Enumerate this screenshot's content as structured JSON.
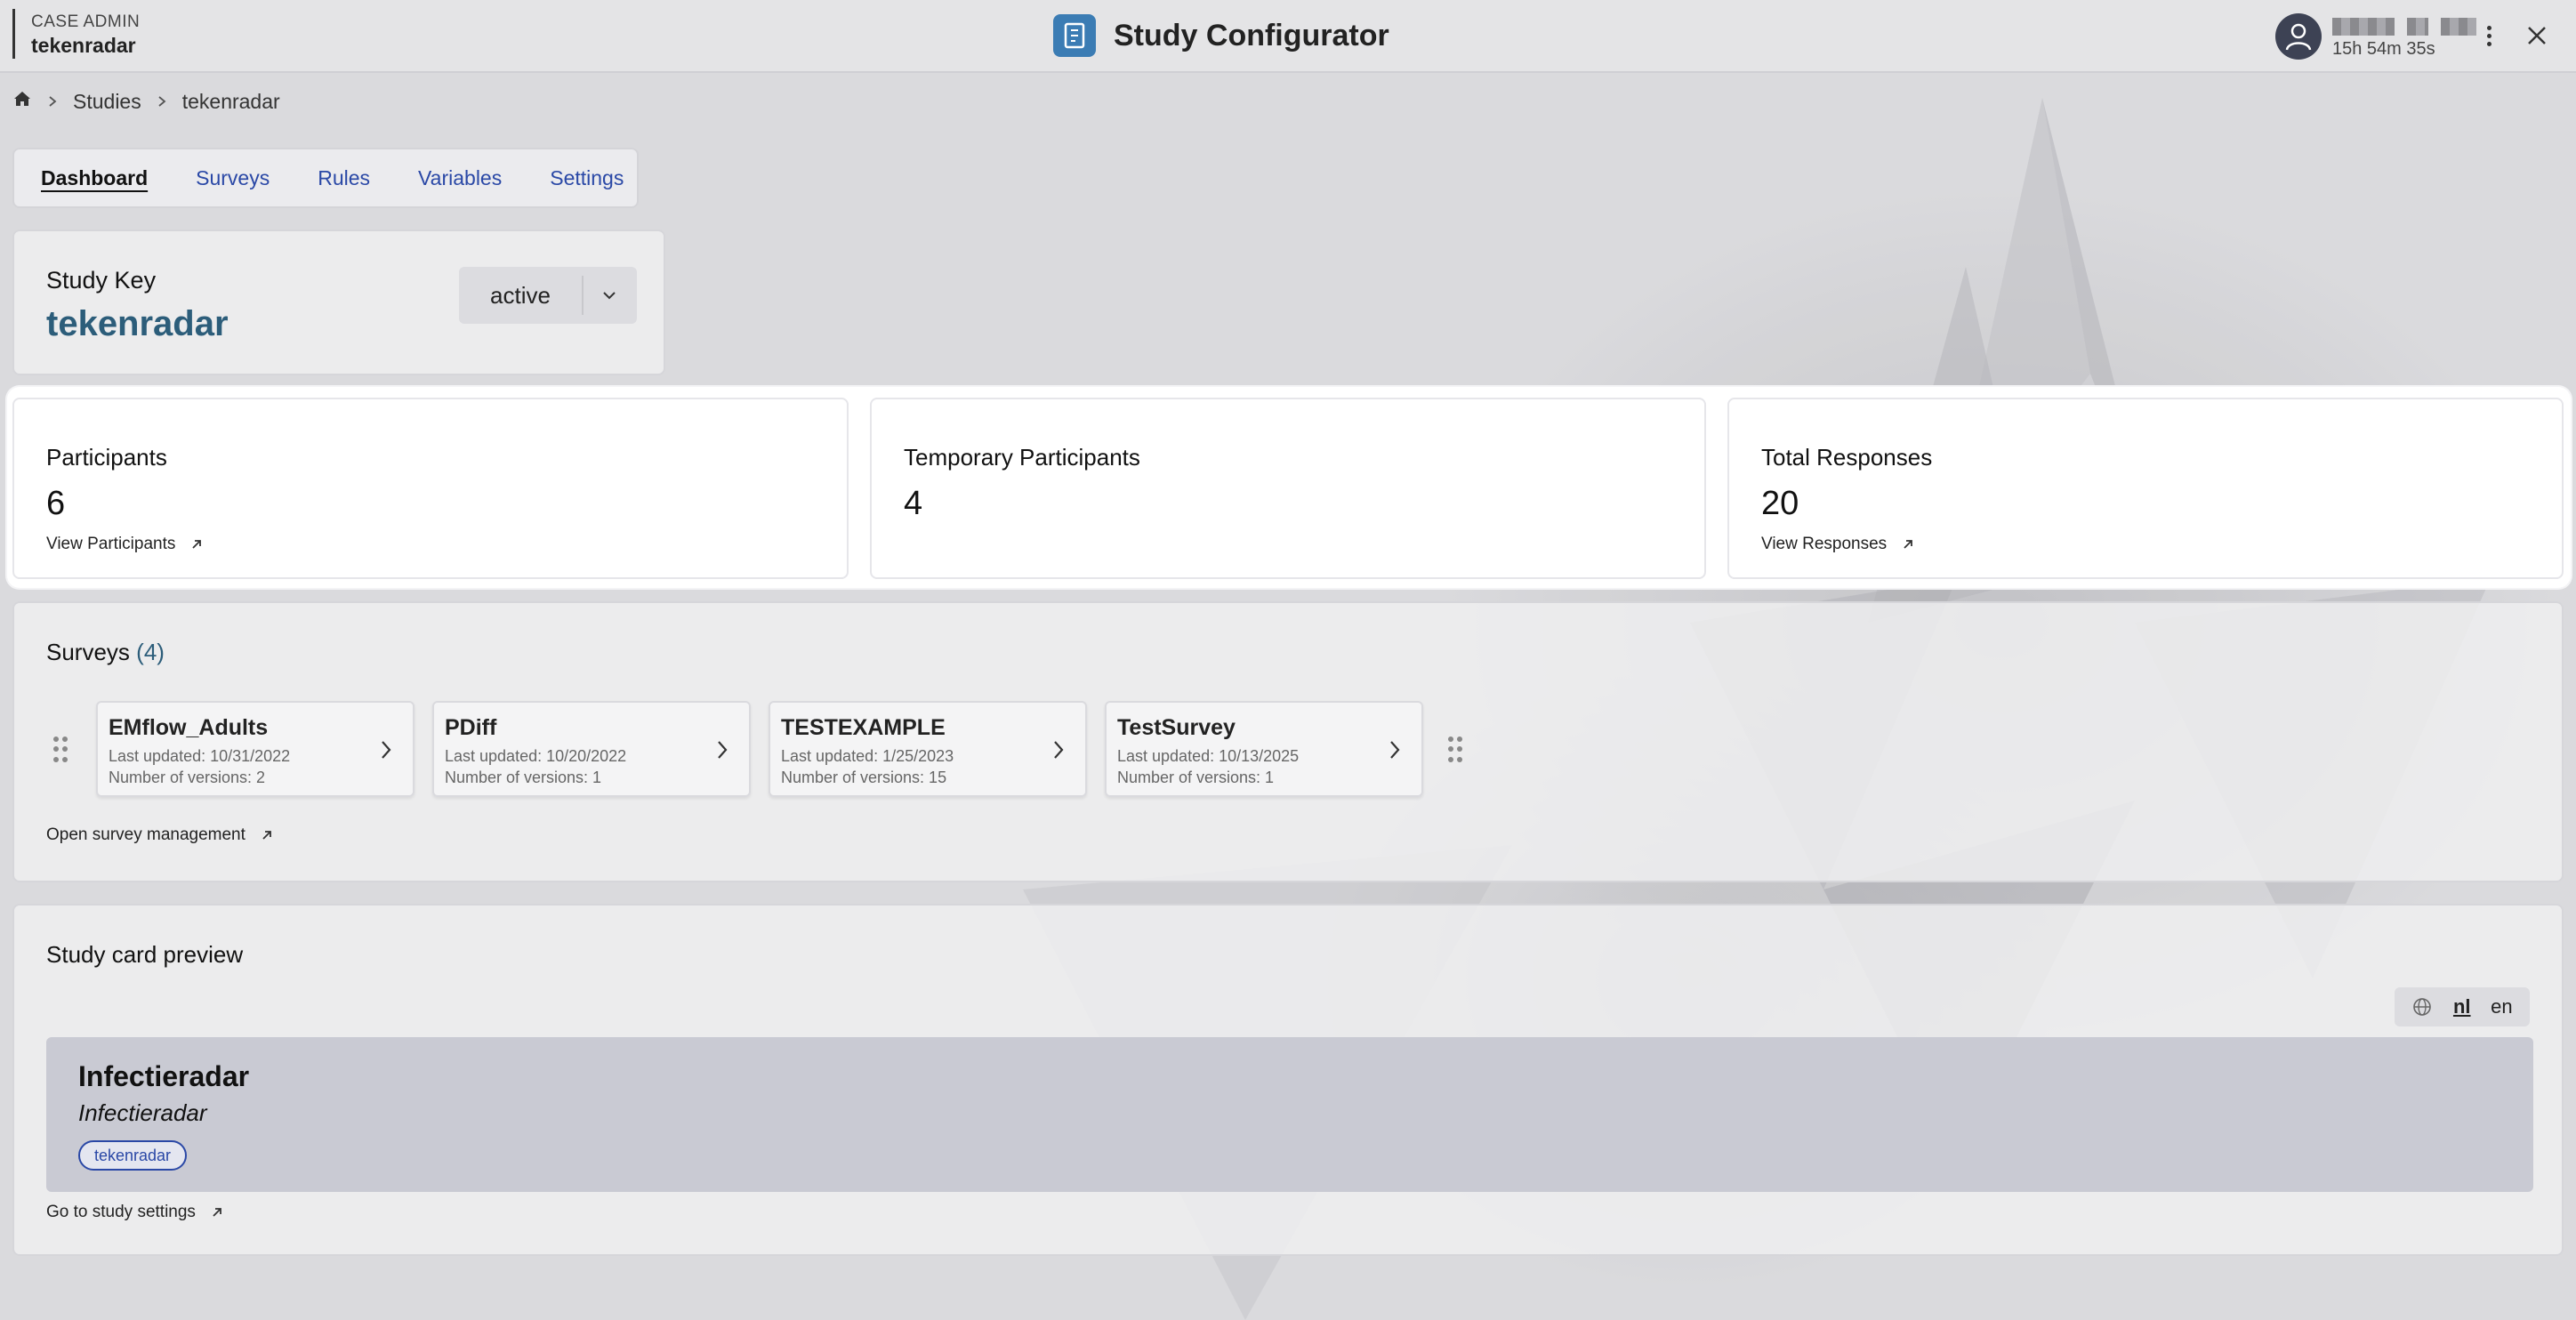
{
  "header": {
    "role_label": "CASE ADMIN",
    "role_name": "tekenradar",
    "app_title": "Study Configurator",
    "session_timer": "15h 54m 35s"
  },
  "breadcrumb": {
    "items": [
      "Studies",
      "tekenradar"
    ]
  },
  "tabs": [
    {
      "label": "Dashboard",
      "active": true
    },
    {
      "label": "Surveys",
      "active": false
    },
    {
      "label": "Rules",
      "active": false
    },
    {
      "label": "Variables",
      "active": false
    },
    {
      "label": "Settings",
      "active": false
    }
  ],
  "study_key": {
    "label": "Study Key",
    "value": "tekenradar",
    "status": "active"
  },
  "stats": [
    {
      "title": "Participants",
      "value": "6",
      "link": "View Participants"
    },
    {
      "title": "Temporary Participants",
      "value": "4",
      "link": ""
    },
    {
      "title": "Total Responses",
      "value": "20",
      "link": "View Responses"
    }
  ],
  "surveys": {
    "title": "Surveys",
    "count": "(4)",
    "items": [
      {
        "name": "EMflow_Adults",
        "updated": "Last updated: 10/31/2022",
        "versions": "Number of versions: 2"
      },
      {
        "name": "PDiff",
        "updated": "Last updated: 10/20/2022",
        "versions": "Number of versions: 1"
      },
      {
        "name": "TESTEXAMPLE",
        "updated": "Last updated: 1/25/2023",
        "versions": "Number of versions: 15"
      },
      {
        "name": "TestSurvey",
        "updated": "Last updated: 10/13/2025",
        "versions": "Number of versions: 1"
      }
    ],
    "management_link": "Open survey management"
  },
  "preview": {
    "title": "Study card preview",
    "languages": [
      "nl",
      "en"
    ],
    "selected_language": "nl",
    "card_title": "Infectieradar",
    "card_subtitle": "Infectieradar",
    "card_tag": "tekenradar",
    "settings_link": "Go to study settings"
  },
  "colors": {
    "accent": "#2a48a6",
    "study_key": "#2c5d7a",
    "app_icon": "#3b7cb4"
  }
}
